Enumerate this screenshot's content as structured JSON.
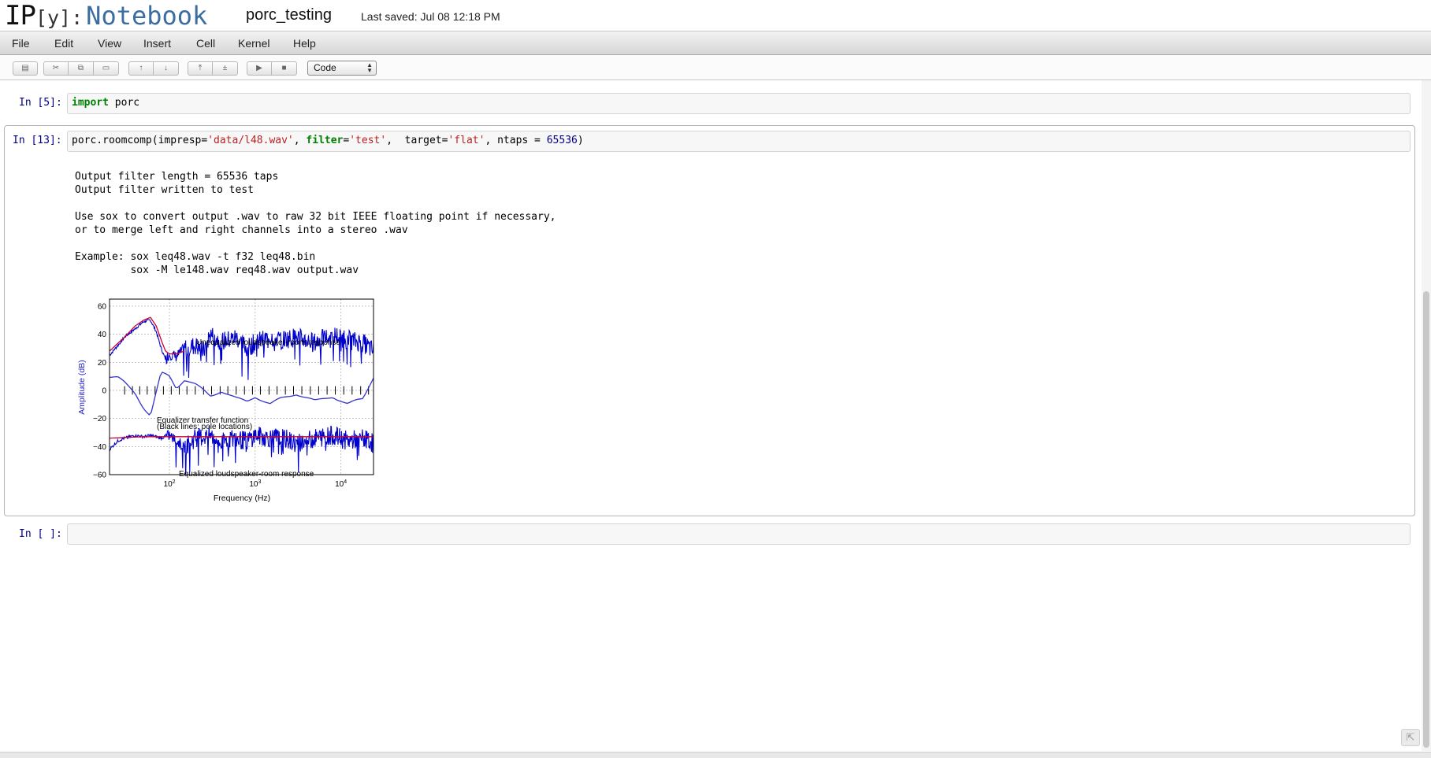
{
  "header": {
    "logo_ip": "IP",
    "logo_y": "[y]:",
    "logo_notebook": "Notebook",
    "notebook_name": "porc_testing",
    "save_status": "Last saved: Jul 08 12:18 PM"
  },
  "menubar": {
    "items": [
      {
        "label": "File"
      },
      {
        "label": "Edit"
      },
      {
        "label": "View"
      },
      {
        "label": "Insert"
      },
      {
        "label": "Cell"
      },
      {
        "label": "Kernel"
      },
      {
        "label": "Help"
      }
    ]
  },
  "toolbar": {
    "buttons": [
      {
        "icon": "save-icon"
      },
      {
        "icon": "cut-icon"
      },
      {
        "icon": "copy-icon"
      },
      {
        "icon": "paste-icon"
      },
      {
        "icon": "move-up-icon"
      },
      {
        "icon": "move-down-icon"
      },
      {
        "icon": "insert-above-icon"
      },
      {
        "icon": "insert-below-icon"
      },
      {
        "icon": "run-icon"
      },
      {
        "icon": "stop-icon"
      }
    ],
    "cell_type": "Code"
  },
  "cells": [
    {
      "prompt": "In [5]:",
      "code_keyword": "import",
      "code_rest": " porc"
    },
    {
      "prompt": "In [13]:",
      "code_tokens": [
        {
          "t": "porc.roomcomp(impresp=",
          "c": ""
        },
        {
          "t": "'data/l48.wav'",
          "c": "str"
        },
        {
          "t": ", ",
          "c": ""
        },
        {
          "t": "filter",
          "c": "kw"
        },
        {
          "t": "=",
          "c": ""
        },
        {
          "t": "'test'",
          "c": "str"
        },
        {
          "t": ",  target=",
          "c": ""
        },
        {
          "t": "'flat'",
          "c": "str"
        },
        {
          "t": ", ntaps = ",
          "c": ""
        },
        {
          "t": "65536",
          "c": "num"
        },
        {
          "t": ")",
          "c": ""
        }
      ],
      "output_lines": [
        "Output filter length = 65536 taps",
        "Output filter written to test",
        "",
        "Use sox to convert output .wav to raw 32 bit IEEE floating point if necessary,",
        "or to merge left and right channels into a stereo .wav",
        "",
        "Example: sox leq48.wav -t f32 leq48.bin",
        "         sox -M le148.wav req48.wav output.wav"
      ]
    },
    {
      "prompt": "In [ ]:"
    }
  ],
  "chart_data": {
    "type": "line",
    "title": "",
    "xlabel": "Frequency (Hz)",
    "ylabel": "Amplitude (dB)",
    "xscale": "log",
    "xlim": [
      20,
      24000
    ],
    "ylim": [
      -60,
      65
    ],
    "x_tick_labels": [
      "10^2",
      "10^3",
      "10^4"
    ],
    "y_ticks": [
      60,
      40,
      20,
      0,
      -20,
      -40,
      -60
    ],
    "grid": true,
    "annotations": [
      "Unequalized loudspeaker-room response",
      "Equalizer transfer function",
      "(Black lines: pole locations)",
      "Equalized loudspeaker-room response"
    ],
    "series": [
      {
        "color": "#0000cc",
        "x": [
          20,
          25,
          30,
          40,
          50,
          60,
          70,
          80,
          90,
          100,
          120,
          150,
          200,
          250,
          300,
          400,
          500,
          600,
          800,
          1000,
          1500,
          2000,
          3000,
          5000,
          8000,
          12000,
          18000,
          24000
        ],
        "y": [
          25,
          32,
          38,
          44,
          49,
          50,
          42,
          30,
          22,
          26,
          24,
          30,
          32,
          28,
          40,
          35,
          36,
          38,
          30,
          34,
          38,
          36,
          38,
          34,
          40,
          36,
          34,
          28
        ]
      },
      {
        "color": "#cc0033",
        "x": [
          20,
          30,
          40,
          50,
          60,
          70,
          80,
          90,
          100,
          120,
          150
        ],
        "y": [
          28,
          38,
          46,
          50,
          52,
          46,
          36,
          28,
          26,
          26,
          28
        ]
      },
      {
        "color": "#3333cc",
        "x": [
          20,
          25,
          30,
          40,
          50,
          60,
          70,
          80,
          100,
          120,
          150,
          200,
          300,
          400,
          600,
          800,
          1000,
          1500,
          2000,
          3000,
          5000,
          8000,
          12000,
          18000,
          24000
        ],
        "y": [
          10,
          9,
          5,
          -2,
          -12,
          -18,
          -2,
          12,
          10,
          2,
          8,
          4,
          -4,
          0,
          -6,
          -8,
          -4,
          -10,
          -6,
          -2,
          -8,
          -4,
          -10,
          -6,
          10
        ]
      },
      {
        "color": "#0000cc",
        "x": [
          20,
          25,
          30,
          40,
          50,
          60,
          80,
          100,
          120,
          150,
          200,
          300,
          400,
          500,
          800,
          1000,
          1500,
          2000,
          3000,
          5000,
          8000,
          12000,
          18000,
          24000
        ],
        "y": [
          -42,
          -36,
          -34,
          -32,
          -33,
          -32,
          -34,
          -32,
          -36,
          -40,
          -34,
          -32,
          -38,
          -34,
          -36,
          -32,
          -34,
          -33,
          -38,
          -34,
          -32,
          -36,
          -34,
          -38
        ]
      },
      {
        "color": "#cc0033",
        "x": [
          20,
          50,
          100,
          1000,
          24000
        ],
        "y": [
          -34,
          -33,
          -33,
          -33,
          -33
        ]
      }
    ],
    "pole_locations_hz": [
      30,
      37,
      45,
      55,
      68,
      85,
      105,
      130,
      160,
      200,
      250,
      310,
      390,
      480,
      600,
      750,
      930,
      1150,
      1450,
      1800,
      2250,
      2800,
      3500,
      4400,
      5500,
      6900,
      8600,
      10800,
      13500,
      17000,
      21000
    ]
  }
}
